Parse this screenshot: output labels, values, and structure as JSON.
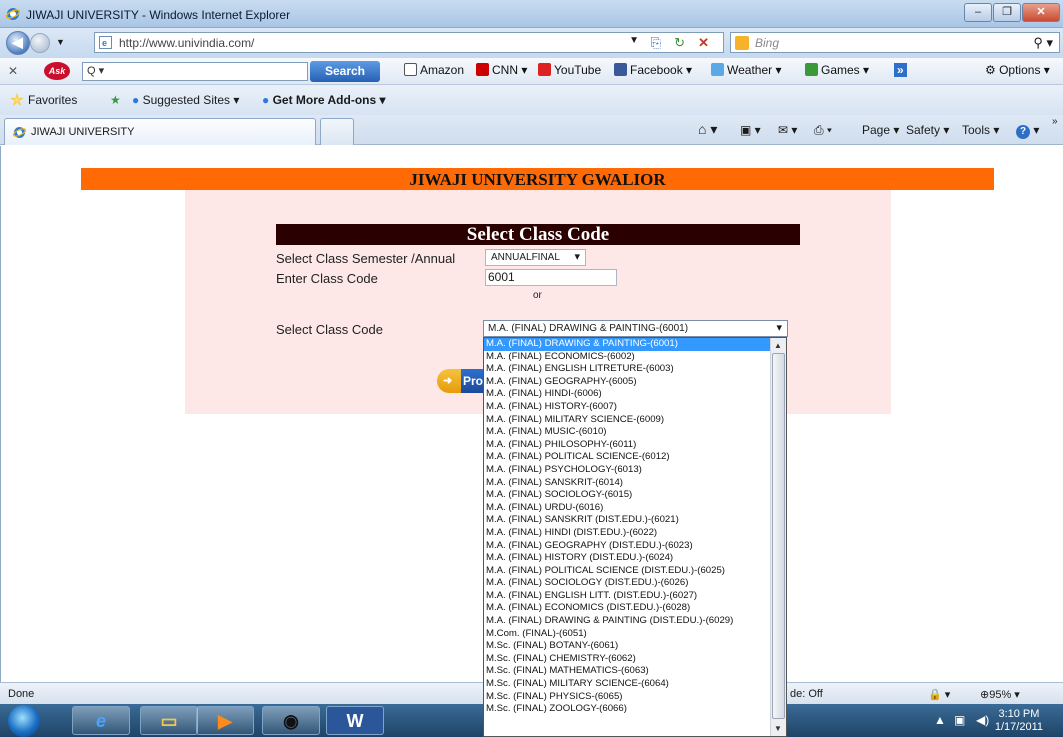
{
  "window": {
    "title": "JIWAJI UNIVERSITY - Windows Internet Explorer"
  },
  "address_bar": {
    "url": "http://www.univindia.com/",
    "search_placeholder": "Bing"
  },
  "ask_toolbar": {
    "search_value": "Q ▾",
    "search_label": "Search",
    "links": [
      "Amazon",
      "CNN ▾",
      "YouTube",
      "Facebook ▾",
      "Weather ▾",
      "Games ▾"
    ],
    "options_label": "Options ▾"
  },
  "favorites_bar": {
    "favorites_label": "Favorites",
    "suggested_sites": "Suggested Sites ▾",
    "more_addons": "Get More Add-ons ▾"
  },
  "tab": {
    "label": "JIWAJI UNIVERSITY"
  },
  "command_bar": {
    "page": "Page ▾",
    "safety": "Safety ▾",
    "tools": "Tools ▾"
  },
  "page": {
    "banner": "JIWAJI UNIVERSITY GWALIOR",
    "heading": "Select Class Code",
    "semester_label": "Select Class Semester /Annual",
    "semester_value": "ANNUALFINAL",
    "class_code_label": "Enter Class Code",
    "class_code_value": "6001",
    "or_text": "or",
    "select_class_label": "Select Class Code",
    "select_class_value": "M.A. (FINAL) DRAWING & PAINTING-(6001)",
    "proceed_label": "Pro",
    "options": [
      "M.A. (FINAL) DRAWING & PAINTING-(6001)",
      "M.A. (FINAL) ECONOMICS-(6002)",
      "M.A. (FINAL) ENGLISH LITRETURE-(6003)",
      "M.A. (FINAL) GEOGRAPHY-(6005)",
      "M.A. (FINAL) HINDI-(6006)",
      "M.A. (FINAL) HISTORY-(6007)",
      "M.A. (FINAL) MILITARY SCIENCE-(6009)",
      "M.A. (FINAL) MUSIC-(6010)",
      "M.A. (FINAL) PHILOSOPHY-(6011)",
      "M.A. (FINAL) POLITICAL SCIENCE-(6012)",
      "M.A. (FINAL) PSYCHOLOGY-(6013)",
      "M.A. (FINAL) SANSKRIT-(6014)",
      "M.A. (FINAL) SOCIOLOGY-(6015)",
      "M.A. (FINAL) URDU-(6016)",
      "M.A. (FINAL) SANSKRIT (DIST.EDU.)-(6021)",
      "M.A. (FINAL) HINDI (DIST.EDU.)-(6022)",
      "M.A. (FINAL) GEOGRAPHY (DIST.EDU.)-(6023)",
      "M.A. (FINAL) HISTORY (DIST.EDU.)-(6024)",
      "M.A. (FINAL) POLITICAL SCIENCE (DIST.EDU.)-(6025)",
      "M.A. (FINAL) SOCIOLOGY (DIST.EDU.)-(6026)",
      "M.A. (FINAL) ENGLISH LITT. (DIST.EDU.)-(6027)",
      "M.A. (FINAL) ECONOMICS (DIST.EDU.)-(6028)",
      "M.A. (FINAL) DRAWING & PAINTING (DIST.EDU.)-(6029)",
      "M.Com. (FINAL)-(6051)",
      "M.Sc. (FINAL) BOTANY-(6061)",
      "M.Sc. (FINAL) CHEMISTRY-(6062)",
      "M.Sc. (FINAL) MATHEMATICS-(6063)",
      "M.Sc. (FINAL) MILITARY SCIENCE-(6064)",
      "M.Sc. (FINAL) PHYSICS-(6065)",
      "M.Sc. (FINAL) ZOOLOGY-(6066)"
    ]
  },
  "status_bar": {
    "text": "Done",
    "mode_text": "de: Off",
    "zoom": "95%"
  },
  "taskbar": {
    "time": "3:10 PM",
    "date": "1/17/2011"
  },
  "colors": {
    "banner": "#ff6a05",
    "heading_bg": "#2b0000",
    "form_bg": "#fde8e7",
    "selection": "#3399ff"
  }
}
